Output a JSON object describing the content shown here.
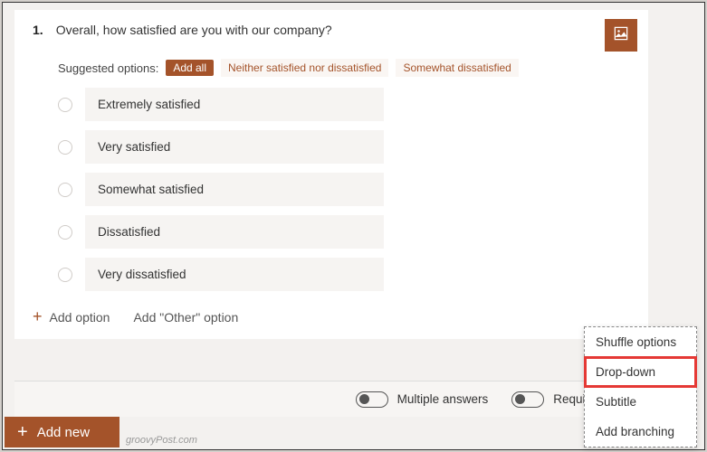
{
  "question": {
    "number": "1.",
    "text": "Overall, how satisfied are you with our company?"
  },
  "suggest": {
    "label": "Suggested options:",
    "addAll": "Add all",
    "items": [
      "Neither satisfied nor dissatisfied",
      "Somewhat dissatisfied"
    ]
  },
  "options": [
    "Extremely satisfied",
    "Very satisfied",
    "Somewhat satisfied",
    "Dissatisfied",
    "Very dissatisfied"
  ],
  "actions": {
    "addOption": "Add option",
    "addOther": "Add \"Other\" option"
  },
  "toggles": {
    "multiple": "Multiple answers",
    "required": "Required"
  },
  "addNew": "Add new",
  "watermark": "groovyPost.com",
  "menu": [
    "Shuffle options",
    "Drop-down",
    "Subtitle",
    "Add branching"
  ]
}
